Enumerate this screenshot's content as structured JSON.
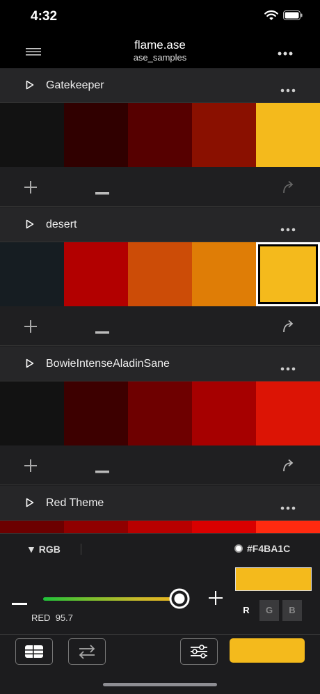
{
  "status_bar": {
    "time": "4:32"
  },
  "navbar": {
    "title": "flame.ase",
    "subtitle": "ase_samples"
  },
  "groups": [
    {
      "name": "Gatekeeper",
      "colors": [
        "#121212",
        "#300000",
        "#560000",
        "#8a1000",
        "#f4ba1c"
      ]
    },
    {
      "name": "desert",
      "colors": [
        "#161d22",
        "#b20000",
        "#cc4c07",
        "#df7d06",
        "#f4ba1c"
      ],
      "selected_index": 4
    },
    {
      "name": "BowieIntenseAladinSane",
      "colors": [
        "#121212",
        "#3d0000",
        "#6e0000",
        "#a60000",
        "#dc1405"
      ]
    },
    {
      "name": "Red Theme",
      "colors": [
        "#6c0000",
        "#900000",
        "#b80000",
        "#d90000",
        "#ff2a10"
      ]
    }
  ],
  "editor": {
    "mode_label": "RGB",
    "hex_label": "#F4BA1C",
    "current_color": "#F4BA1C",
    "channel_label": "RED",
    "channel_value": "95.7",
    "channel_fraction": 0.957,
    "channels": [
      {
        "label": "R",
        "active": true
      },
      {
        "label": "G",
        "active": false
      },
      {
        "label": "B",
        "active": false
      }
    ]
  },
  "toolbar": {
    "primary_color": "#F4BA1C"
  }
}
